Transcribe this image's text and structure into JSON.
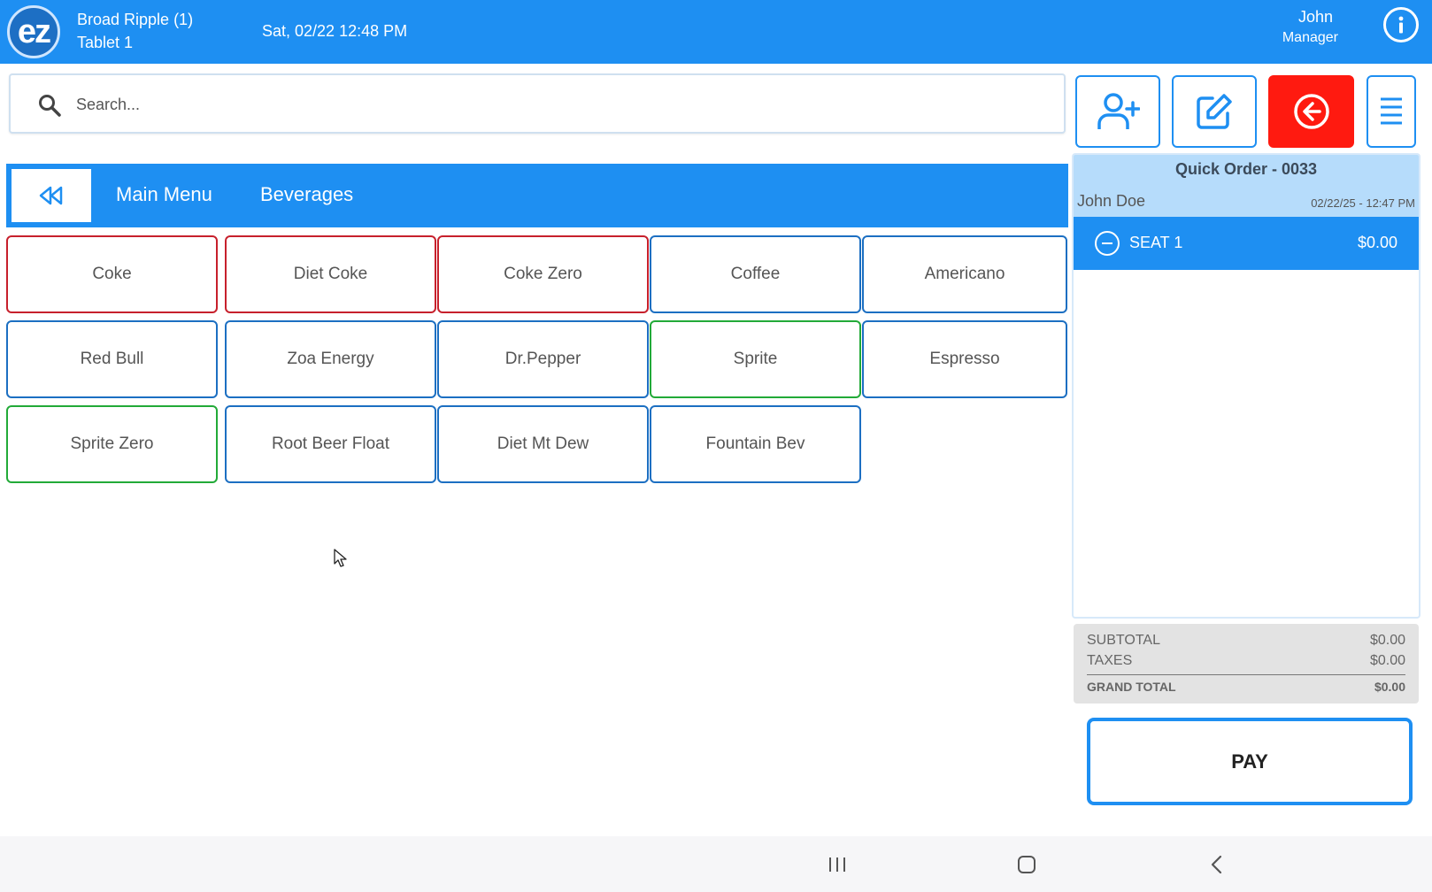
{
  "header": {
    "logo_text": "ez",
    "store_name": "Broad Ripple (1)",
    "device_name": "Tablet 1",
    "datetime": "Sat, 02/22 12:48 PM",
    "user_name": "John",
    "user_role": "Manager",
    "info_icon": "info-icon"
  },
  "search": {
    "placeholder": "Search..."
  },
  "actions": {
    "add_customer_icon": "add-user-icon",
    "edit_icon": "edit-icon",
    "exit_icon": "back-arrow-icon",
    "menu_icon": "hamburger-menu-icon",
    "exit_color": "#ff1a10"
  },
  "category_bar": {
    "back_icon": "double-chevron-left-icon",
    "crumbs": [
      "Main Menu",
      "Beverages"
    ]
  },
  "items": [
    {
      "label": "Coke",
      "color": "#c7202c"
    },
    {
      "label": "Diet Coke",
      "color": "#c7202c"
    },
    {
      "label": "Coke Zero",
      "color": "#c7202c"
    },
    {
      "label": "Coffee",
      "color": "#1c6fc2"
    },
    {
      "label": "Americano",
      "color": "#1c6fc2"
    },
    {
      "label": "Red Bull",
      "color": "#1c6fc2"
    },
    {
      "label": "Zoa Energy",
      "color": "#1c6fc2"
    },
    {
      "label": "Dr.Pepper",
      "color": "#1c6fc2"
    },
    {
      "label": "Sprite",
      "color": "#22aa38"
    },
    {
      "label": "Espresso",
      "color": "#1c6fc2"
    },
    {
      "label": "Sprite Zero",
      "color": "#22aa38"
    },
    {
      "label": "Root Beer Float",
      "color": "#1c6fc2"
    },
    {
      "label": "Diet Mt Dew",
      "color": "#1c6fc2"
    },
    {
      "label": "Fountain Bev",
      "color": "#1c6fc2"
    }
  ],
  "order": {
    "title": "Quick Order - 0033",
    "customer": "John Doe",
    "time": "02/22/25 - 12:47 PM",
    "seat_label": "SEAT 1",
    "seat_amount": "$0.00"
  },
  "totals": {
    "subtotal_label": "SUBTOTAL",
    "subtotal": "$0.00",
    "taxes_label": "TAXES",
    "taxes": "$0.00",
    "grand_label": "GRAND TOTAL",
    "grand": "$0.00"
  },
  "pay_label": "PAY",
  "colors": {
    "accent": "#1e8ff2",
    "order_header": "#b6dcfb",
    "totals_bg": "#e3e3e3"
  }
}
